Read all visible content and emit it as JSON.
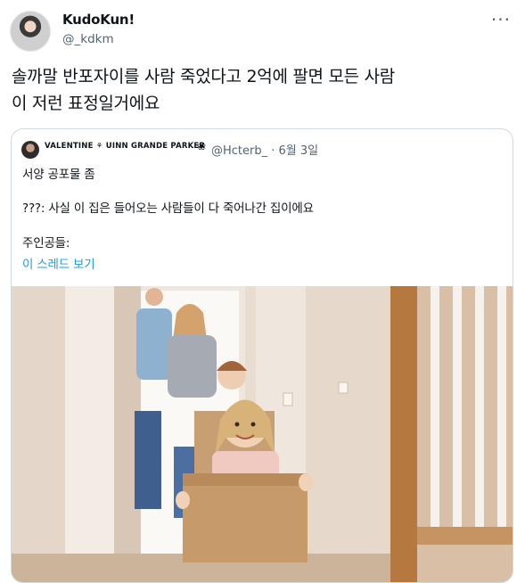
{
  "tweet": {
    "display_name": "KudoKun!",
    "handle": "@_kdkm",
    "more_icon": "···",
    "text_line1": "솔까말 반포자이를 사람 죽었다고 2억에 팔면 모든 사람",
    "text_line2": "이 저런 표정일거에요"
  },
  "quote": {
    "display_name": "VALENTINE ⚘ UINN GRANDE PARKER",
    "badge": "❀",
    "handle_date": "@Hcterb_ · 6월 3일",
    "line1": "서양 공포물 좀",
    "line2": "???: 사실 이 집은 들어오는 사람들이 다 죽어나간 집이에요",
    "line3": "주인공들:",
    "link": "이 스레드 보기"
  }
}
